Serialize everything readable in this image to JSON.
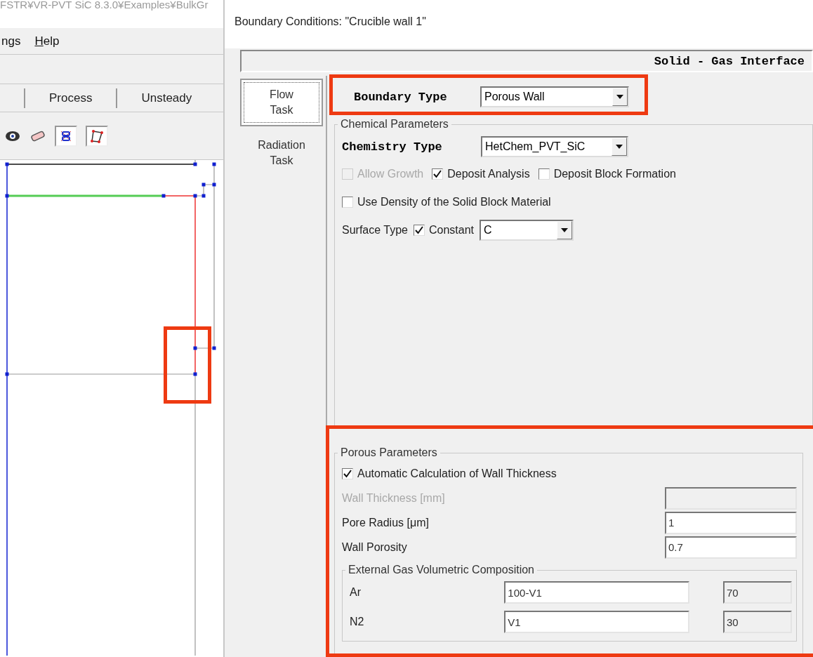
{
  "background_window": {
    "path": "FSTR¥VR-PVT SiC 8.3.0¥Examples¥BulkGr",
    "menu": [
      {
        "label": "ngs",
        "underline_first": false
      },
      {
        "label": "Help",
        "underline_first": true
      }
    ],
    "tabs": [
      {
        "label": "Process"
      },
      {
        "label": "Unsteady"
      }
    ],
    "tools": [
      {
        "kind": "eye",
        "pressed": false
      },
      {
        "kind": "eraser",
        "pressed": false
      },
      {
        "kind": "mesh",
        "pressed": true
      },
      {
        "kind": "polygon",
        "pressed": true
      }
    ]
  },
  "dialog": {
    "title": "Boundary Conditions: \"Crucible wall 1\"",
    "header": "Solid - Gas Interface",
    "side_tabs": [
      {
        "label": "Flow Task",
        "selected": true
      },
      {
        "label": "Radiation Task",
        "selected": false
      }
    ],
    "boundary_type": {
      "label": "Boundary Type",
      "value": "Porous Wall"
    },
    "chemical_parameters": {
      "title": "Chemical Parameters",
      "chemistry_type": {
        "label": "Chemistry Type",
        "value": "HetChem_PVT_SiC"
      },
      "options": [
        {
          "label": "Allow Growth",
          "checked": false,
          "disabled": true
        },
        {
          "label": "Deposit Analysis",
          "checked": true,
          "disabled": false
        },
        {
          "label": "Deposit Block Formation",
          "checked": false,
          "disabled": false
        }
      ],
      "use_density": {
        "label": "Use Density of the Solid Block Material",
        "checked": false
      },
      "surface_type": {
        "label": "Surface Type",
        "constant": {
          "label": "Constant",
          "checked": true
        },
        "value": "C"
      }
    },
    "porous_parameters": {
      "title": "Porous Parameters",
      "auto_thickness": {
        "label": "Automatic Calculation of Wall Thickness",
        "checked": true
      },
      "fields": [
        {
          "label": "Wall Thickness [mm]",
          "disabled": true
        },
        {
          "label": "Pore Radius [μm]",
          "value": "1",
          "disabled": false
        },
        {
          "label": "Wall Porosity",
          "value": "0.7",
          "disabled": false
        }
      ],
      "composition": {
        "title": "External Gas Volumetric Composition",
        "rows": [
          {
            "gas": "Ar",
            "expression": "100-V1",
            "value": "70"
          },
          {
            "gas": "N2",
            "expression": "V1",
            "value": "30"
          }
        ]
      }
    }
  }
}
